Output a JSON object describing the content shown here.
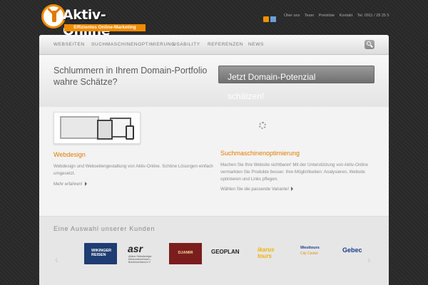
{
  "header": {
    "logo_text": "Aktiv-Online",
    "logo_tagline": "Effizientes Online-Marketing",
    "top_links": [
      "Über uns",
      "Team",
      "Preisliste",
      "Kontakt"
    ],
    "contact": "Tel. 0911 / 28 25 5"
  },
  "nav": {
    "items": [
      "WEBSEITEN",
      "SUCHMASCHINENOPTIMIERUNG",
      "USABILITY",
      "REFERENZEN",
      "NEWS"
    ]
  },
  "hero": {
    "text": "Schlummern in Ihrem Domain-Portfolio wahre Schätze?",
    "button_label": "Jetzt Domain-Potenzial schätzen!"
  },
  "webdesign": {
    "title": "Webdesign",
    "text": "Webdesign und Webseitengestaltung von Aktiv-Online. Schöne Lösungen einfach umgesetzt.",
    "link": "Mehr erfahren!"
  },
  "seo": {
    "title": "Suchmaschinenoptimierung",
    "text": "Machen Sie Ihre Website sichtbarer! Mit der Unterstützung von Aktiv-Online vermarkten Sie Produkte besser. Ihre Möglichkeiten: Analysieren, Website optimieren und Links pflegen.",
    "link": "Wählen Sie die passende Variante!"
  },
  "clients": {
    "title": "Eine Auswahl unserer Kunden",
    "logos": {
      "c1": "WIKINGER REISEN",
      "c2_big": "asr",
      "c2_small": "Allianz Selbständiger Reiseunternehmen – Bundesverband e.V.",
      "c3": "DJAMIR",
      "c4": "GEOPLAN",
      "c5": "ikarus tours",
      "c6_a": "Westtours",
      "c6_b": "City Center",
      "c7": "Gebec"
    }
  },
  "colors": {
    "accent": "#e07b00",
    "hero_button": "#8a8a8a"
  },
  "icons": [
    "rss-icon",
    "social-icon",
    "search-icon",
    "spinner-icon",
    "chevron-left-icon",
    "chevron-right-icon"
  ]
}
